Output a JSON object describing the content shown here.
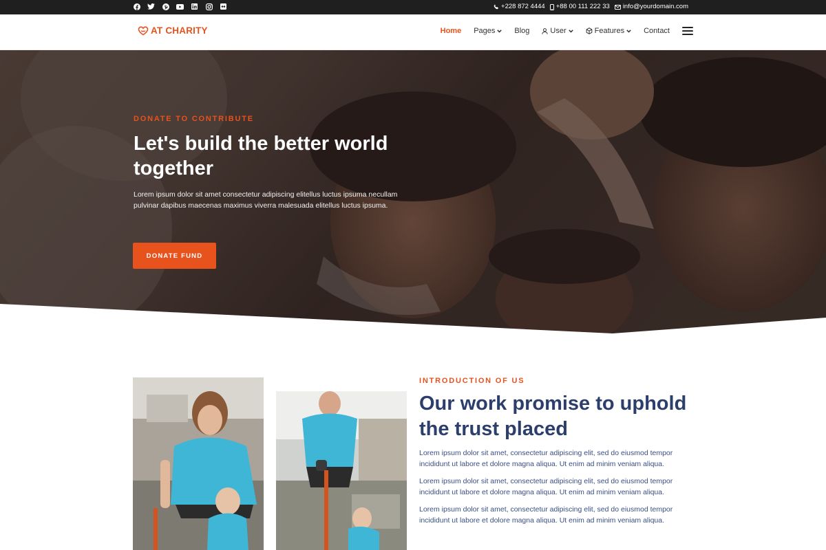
{
  "colors": {
    "accent": "#e8521d",
    "navy": "#2c3e6b",
    "topbar": "#1f1f1f"
  },
  "topbar": {
    "socials": [
      "facebook-icon",
      "twitter-icon",
      "pinterest-icon",
      "youtube-icon",
      "linkedin-icon",
      "instagram-icon",
      "flickr-icon"
    ],
    "phone": "+228 872 4444",
    "mobile": "+88 00 111 222 33",
    "email": "info@yourdomain.com"
  },
  "nav": {
    "logo": "AT CHARITY",
    "items": [
      {
        "label": "Home",
        "active": true
      },
      {
        "label": "Pages"
      },
      {
        "label": "Blog"
      },
      {
        "label": "User"
      },
      {
        "label": "Features"
      },
      {
        "label": "Contact"
      }
    ]
  },
  "hero": {
    "eyebrow": "DONATE TO CONTRIBUTE",
    "title": "Let's build the better world together",
    "description": "Lorem ipsum dolor sit amet consectetur adipiscing elitellus luctus ipsuma necullam pulvinar dapibus maecenas maximus viverra malesuada elitellus luctus ipsuma.",
    "button": "DONATE FUND"
  },
  "intro": {
    "eyebrow": "INTRODUCTION OF US",
    "title": "Our work promise to uphold the trust placed",
    "paragraphs": [
      "Lorem ipsum dolor sit amet, consectetur adipiscing elit, sed do eiusmod tempor incididunt ut labore et dolore magna aliqua. Ut enim ad minim veniam aliqua.",
      "Lorem ipsum dolor sit amet, consectetur adipiscing elit, sed do eiusmod tempor incididunt ut labore et dolore magna aliqua. Ut enim ad minim veniam aliqua.",
      "Lorem ipsum dolor sit amet, consectetur adipiscing elit, sed do eiusmod tempor incididunt ut labore et dolore magna aliqua. Ut enim ad minim veniam aliqua."
    ]
  }
}
